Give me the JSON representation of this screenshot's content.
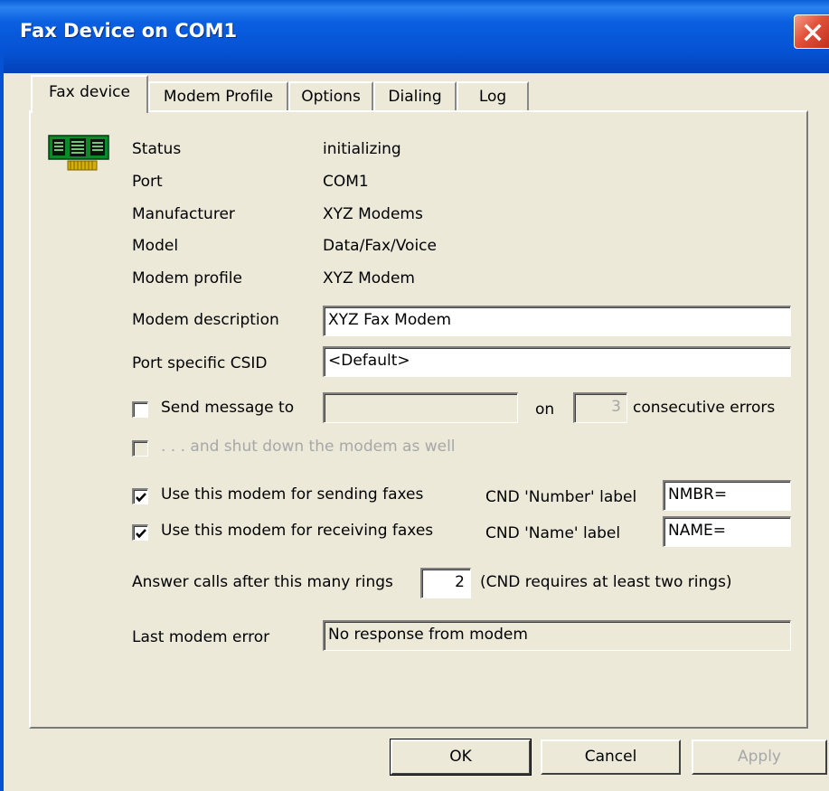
{
  "window": {
    "title": "Fax Device on COM1"
  },
  "tabs": [
    {
      "label": "Fax device"
    },
    {
      "label": "Modem Profile"
    },
    {
      "label": "Options"
    },
    {
      "label": "Dialing"
    },
    {
      "label": "Log"
    }
  ],
  "info": {
    "status_label": "Status",
    "status_value": "initializing",
    "port_label": "Port",
    "port_value": "COM1",
    "manufacturer_label": "Manufacturer",
    "manufacturer_value": "XYZ Modems",
    "model_label": "Model",
    "model_value": "Data/Fax/Voice",
    "profile_label": "Modem profile",
    "profile_value": "XYZ Modem"
  },
  "fields": {
    "description_label": "Modem description",
    "description_value": "XYZ Fax Modem",
    "csid_label": "Port specific CSID",
    "csid_value": "<Default>"
  },
  "errors": {
    "send_message_label": "Send message to",
    "send_message_checked": false,
    "recipient_value": "",
    "on_label": "on",
    "count_value": "3",
    "consecutive_label": "consecutive errors",
    "shutdown_label": ". . . and shut down the modem as well",
    "shutdown_checked": false
  },
  "usage": {
    "sending_label": "Use this modem for sending faxes",
    "sending_checked": true,
    "receiving_label": "Use this modem for receiving faxes",
    "receiving_checked": true,
    "cnd_number_label": "CND 'Number' label",
    "cnd_number_value": "NMBR=",
    "cnd_name_label": "CND 'Name' label",
    "cnd_name_value": "NAME="
  },
  "rings": {
    "label": "Answer calls after this many rings",
    "value": "2",
    "note": "(CND requires at least two rings)"
  },
  "last_error": {
    "label": "Last modem error",
    "value": "No response from modem"
  },
  "buttons": {
    "ok": "OK",
    "cancel": "Cancel",
    "apply": "Apply"
  },
  "icons": {
    "modem": "modem-card-icon",
    "close": "close-icon",
    "check": "checkmark-icon"
  },
  "colors": {
    "titlebar": "#0553d4",
    "close": "#e2513a",
    "face": "#ece9d8"
  }
}
